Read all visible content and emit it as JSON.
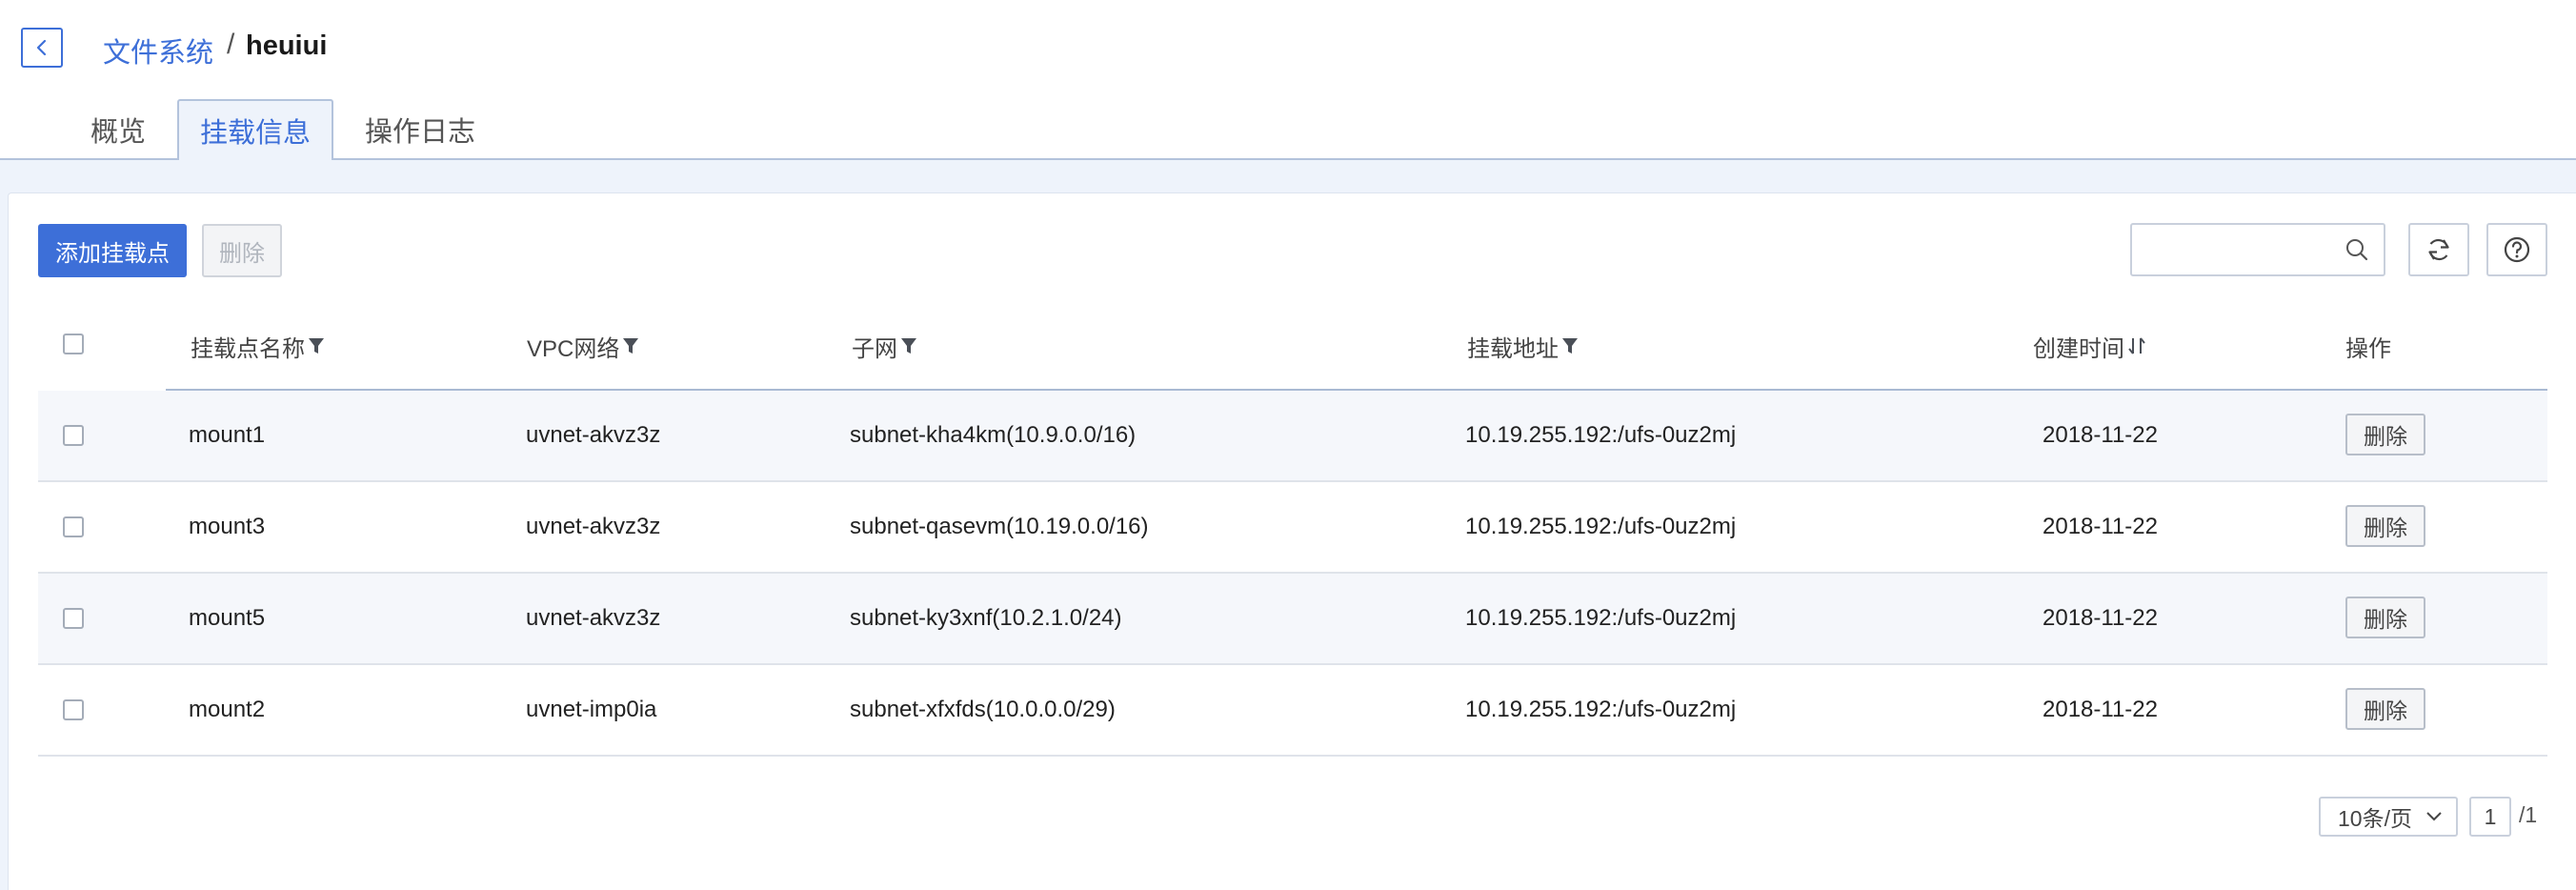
{
  "breadcrumb": {
    "parent": "文件系统",
    "separator": "/",
    "current": "heuiui"
  },
  "tabs": [
    {
      "label": "概览",
      "active": false
    },
    {
      "label": "挂载信息",
      "active": true
    },
    {
      "label": "操作日志",
      "active": false
    }
  ],
  "toolbar": {
    "add_label": "添加挂载点",
    "delete_label": "删除",
    "search_value": ""
  },
  "table": {
    "columns": [
      "挂载点名称",
      "VPC网络",
      "子网",
      "挂载地址",
      "创建时间",
      "操作"
    ],
    "rows": [
      {
        "name": "mount1",
        "vpc": "uvnet-akvz3z",
        "subnet": "subnet-kha4km(10.9.0.0/16)",
        "address": "10.19.255.192:/ufs-0uz2mj",
        "created": "2018-11-22",
        "action": "删除"
      },
      {
        "name": "mount3",
        "vpc": "uvnet-akvz3z",
        "subnet": "subnet-qasevm(10.19.0.0/16)",
        "address": "10.19.255.192:/ufs-0uz2mj",
        "created": "2018-11-22",
        "action": "删除"
      },
      {
        "name": "mount5",
        "vpc": "uvnet-akvz3z",
        "subnet": "subnet-ky3xnf(10.2.1.0/24)",
        "address": "10.19.255.192:/ufs-0uz2mj",
        "created": "2018-11-22",
        "action": "删除"
      },
      {
        "name": "mount2",
        "vpc": "uvnet-imp0ia",
        "subnet": "subnet-xfxfds(10.0.0.0/29)",
        "address": "10.19.255.192:/ufs-0uz2mj",
        "created": "2018-11-22",
        "action": "删除"
      }
    ]
  },
  "pagination": {
    "page_size": "10条/页",
    "current_page": "1",
    "total": "/1"
  },
  "colors": {
    "accent": "#3d6fd8",
    "background": "#eef3fb",
    "row_alt": "#f5f7fb"
  },
  "icons": {
    "back": "chevron-left-icon",
    "search": "search-icon",
    "refresh": "refresh-icon",
    "help": "help-icon",
    "filter": "filter-icon",
    "sort": "sort-icon"
  }
}
